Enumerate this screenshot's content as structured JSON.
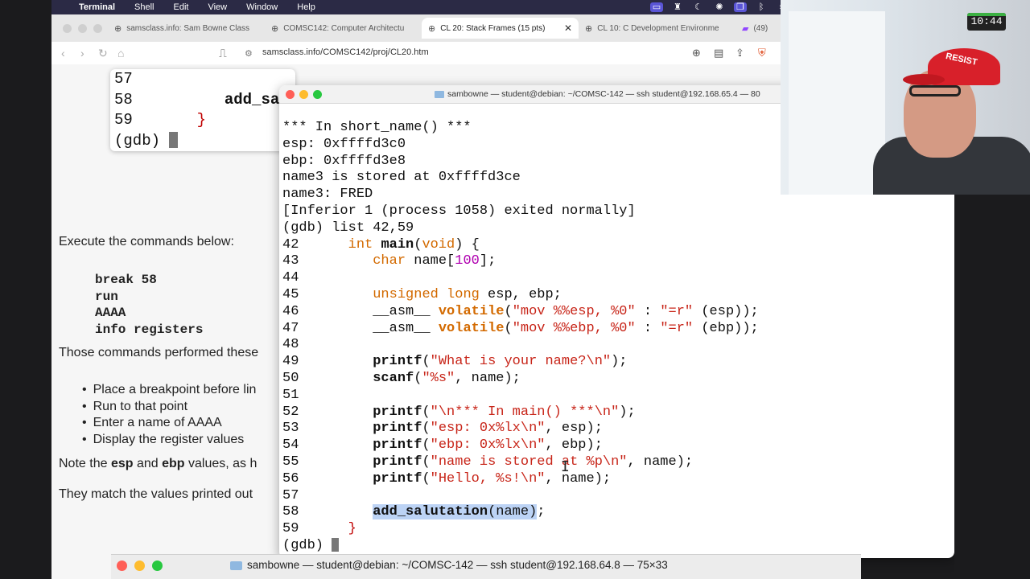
{
  "menubar": {
    "app_name": "Terminal",
    "items": [
      "Shell",
      "Edit",
      "View",
      "Window",
      "Help"
    ]
  },
  "browser": {
    "tabs": [
      {
        "label": "samsclass.info: Sam Bowne Class"
      },
      {
        "label": "COMSC142: Computer Architectu"
      },
      {
        "label": "CL 20: Stack Frames (15 pts)"
      },
      {
        "label": "CL 10: C Development Environme"
      },
      {
        "label": "(49)"
      }
    ],
    "url": "samsclass.info/COMSC142/proj/CL20.htm",
    "page": {
      "execute_text": "Execute the commands below:",
      "commands": [
        "break 58",
        "run",
        "AAAA",
        "info registers"
      ],
      "performed_text": "Those commands performed these",
      "bullets": [
        "Place a breakpoint before lin",
        "Run to that point",
        "Enter a name of AAAA",
        "Display the register values"
      ],
      "note_text_a": "Note the ",
      "note_esp": "esp",
      "note_and": " and ",
      "note_ebp": "ebp",
      "note_text_b": " values, as h",
      "match_text": "They match the values printed out"
    }
  },
  "gdb_small": {
    "lines": [
      {
        "n": "57",
        "code": ""
      },
      {
        "n": "58",
        "code": "add_sa"
      },
      {
        "n": "59",
        "code": "}"
      }
    ],
    "prompt": "(gdb) "
  },
  "terminal": {
    "title": "sambowne — student@debian: ~/COMSC-142 — ssh student@192.168.65.4 — 80",
    "output": [
      "*** In short_name() ***",
      "esp: 0xffffd3c0",
      "ebp: 0xffffd3e8",
      "name3 is stored at 0xffffd3ce",
      "name3: FRED",
      "[Inferior 1 (process 1058) exited normally]",
      "(gdb) list 42,59"
    ],
    "code": {
      "l42": {
        "n": "42",
        "kw": "int",
        "fn": "main",
        "rest": "(",
        "void": "void",
        "end": ") {"
      },
      "l43": {
        "n": "43",
        "kw": "char",
        "rest": " name[",
        "num": "100",
        "end": "];"
      },
      "l44": {
        "n": "44"
      },
      "l45": {
        "n": "45",
        "kw": "unsigned long",
        "rest": " esp, ebp;"
      },
      "l46": {
        "n": "46",
        "a": "__asm__ ",
        "kw": "volatile",
        "b": "(",
        "s1": "\"mov %%esp, %0\"",
        "c": " : ",
        "s2": "\"=r\"",
        "d": " (esp));"
      },
      "l47": {
        "n": "47",
        "a": "__asm__ ",
        "kw": "volatile",
        "b": "(",
        "s1": "\"mov %%ebp, %0\"",
        "c": " : ",
        "s2": "\"=r\"",
        "d": " (ebp));"
      },
      "l48": {
        "n": "48"
      },
      "l49": {
        "n": "49",
        "fn": "printf",
        "b": "(",
        "s": "\"What is your name?\\n\"",
        "d": ");"
      },
      "l50": {
        "n": "50",
        "fn": "scanf",
        "b": "(",
        "s": "\"%s\"",
        "d": ", name);"
      },
      "l51": {
        "n": "51"
      },
      "l52": {
        "n": "52",
        "fn": "printf",
        "b": "(",
        "s": "\"\\n*** In main() ***\\n\"",
        "d": ");"
      },
      "l53": {
        "n": "53",
        "fn": "printf",
        "b": "(",
        "s": "\"esp: 0x%lx\\n\"",
        "d": ", esp);"
      },
      "l54": {
        "n": "54",
        "fn": "printf",
        "b": "(",
        "s": "\"ebp: 0x%lx\\n\"",
        "d": ", ebp);"
      },
      "l55": {
        "n": "55",
        "fn": "printf",
        "b": "(",
        "s": "\"name is stored at %p\\n\"",
        "d": ", name);"
      },
      "l56": {
        "n": "56",
        "fn": "printf",
        "b": "(",
        "s": "\"Hello, %s!\\n\"",
        "d": ", name);"
      },
      "l57": {
        "n": "57"
      },
      "l58": {
        "n": "58",
        "fn": "add_salutation",
        "b": "(name)",
        "d": ";"
      },
      "l59": {
        "n": "59",
        "brace": "}"
      }
    },
    "prompt": "(gdb) "
  },
  "terminal2": {
    "title": "sambowne — student@debian: ~/COMSC-142 — ssh student@192.168.64.8 — 75×33"
  },
  "webcam": {
    "cap_text": "RESIST",
    "clock": "10:44"
  },
  "colors": {
    "keyword": "#d36a00",
    "string": "#c8261a",
    "number": "#b000b0",
    "highlight": "#bcd3f5",
    "menubar": "#2b2a45"
  }
}
